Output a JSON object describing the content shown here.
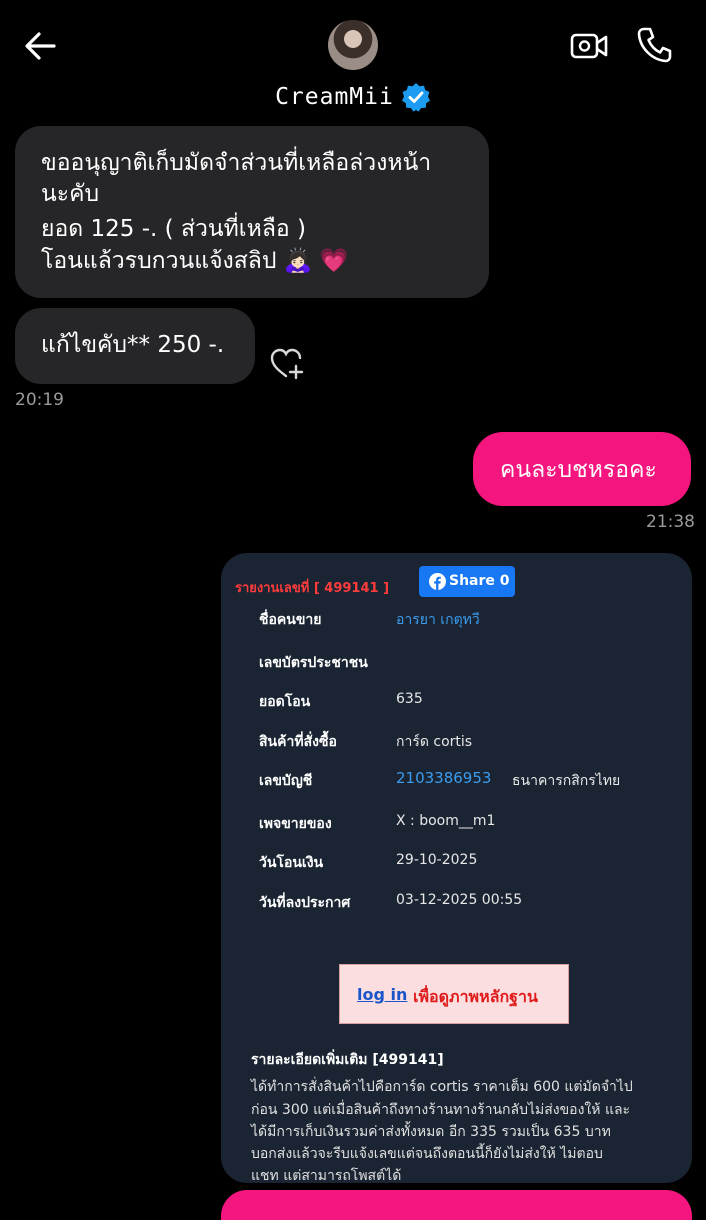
{
  "header": {
    "contact_name": "CreamMii",
    "accent": "#1d9bf0"
  },
  "messages": {
    "incoming_1": [
      "ขออนุญาติเก็บมัดจำส่วนที่เหลือล่วงหน้า",
      "นะคับ",
      "ยอด 125 -. ( ส่วนที่เหลือ )",
      "โอนแล้วรบกวนแจ้งสลิป 🙇🏻‍♀️ 💗"
    ],
    "incoming_2": "แก้ไขคับ** 250 -.",
    "time_1": "20:19",
    "outgoing_1": "คนละบชหรอคะ",
    "outgoing_color": "#f4167e",
    "time_2": "21:38"
  },
  "report": {
    "report_no": "รายงานเลขที่ [ 499141 ]",
    "share_label": "Share 0",
    "rows": [
      {
        "label": "ชื่อคนขาย",
        "value": "อารยา เกตุทวี"
      },
      {
        "label": "เลขบัตรประชาชน",
        "value": ""
      },
      {
        "label": "ยอดโอน",
        "value": "635"
      },
      {
        "label": "สินค้าที่สั่งซื้อ",
        "value": "การ์ด cortis"
      },
      {
        "label": "เลขบัญชี",
        "value": "2103386953",
        "bank": "ธนาคารกสิกรไทย"
      },
      {
        "label": "เพจขายของ",
        "value": "X : boom__m1"
      },
      {
        "label": "วันโอนเงิน",
        "value": "29-10-2025"
      },
      {
        "label": "วันที่ลงประกาศ",
        "value": "03-12-2025 00:55"
      }
    ],
    "login_link": "log in",
    "login_rest": "เพื่อดูภาพหลักฐาน",
    "detail_heading": "รายละเอียดเพิ่มเติม [499141]",
    "detail_lines": [
      "ได้ทำการสั่งสินค้าไปคือการ์ด cortis ราคาเต็ม 600 แต่มัดจำไป",
      "ก่อน 300 แต่เมื่อสินค้าถึงทางร้านทางร้านกลับไม่ส่งของให้ และ",
      "ได้มีการเก็บเงินรวมค่าส่งทั้งหมด อีก 335 รวมเป็น 635 บาท",
      "บอกส่งแล้วจะรีบแจ้งเลขแต่จนถึงตอนนี้ก็ยังไม่ส่งให้ ไม่ตอบ",
      "แชท แต่สามารถโพสต์ได้"
    ]
  }
}
